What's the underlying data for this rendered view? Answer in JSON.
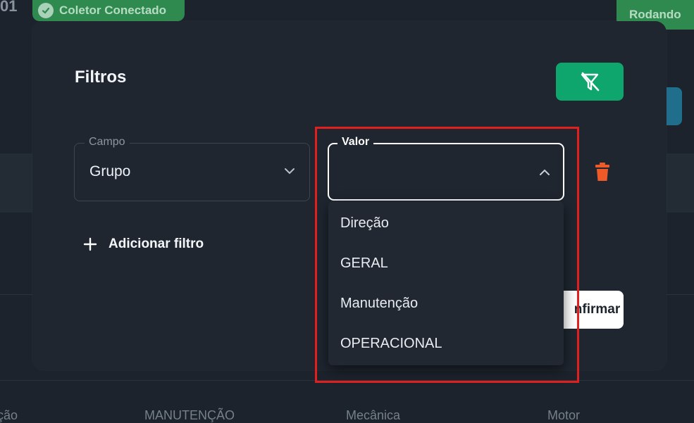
{
  "background": {
    "top_number": "01",
    "collector_badge": "Coletor Conectado",
    "status_badge": "Rodando",
    "table_row": [
      "ção",
      "MANUTENÇÃO",
      "Mecânica",
      "Motor"
    ]
  },
  "modal": {
    "title": "Filtros",
    "campo": {
      "label": "Campo",
      "value": "Grupo"
    },
    "valor": {
      "label": "Valor",
      "value": ""
    },
    "add_filter_label": "Adicionar filtro",
    "confirm_label": "Confirmar",
    "confirm_label_visible": "nfirmar"
  },
  "dropdown": {
    "options": [
      "Direção",
      "GERAL",
      "Manutenção",
      "OPERACIONAL"
    ]
  },
  "colors": {
    "accent_green": "#0fa66e",
    "delete_red": "#f05a28",
    "highlight_red": "#e0201e"
  }
}
